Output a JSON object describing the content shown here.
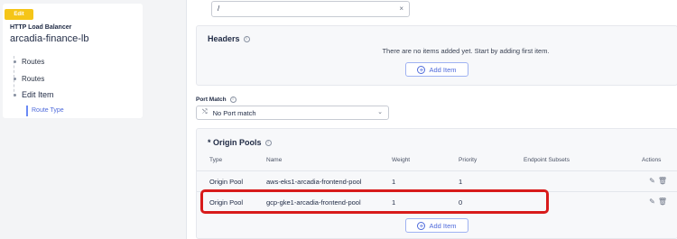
{
  "nav": {
    "badge": "Edit",
    "title": "HTTP Load Balancer",
    "lb_name": "arcadia-finance-lb",
    "items": [
      {
        "label": "Routes"
      },
      {
        "label": "Routes"
      },
      {
        "label": "Edit Item"
      }
    ],
    "sub_item": "Route Type"
  },
  "path_input": {
    "value": "/",
    "clear_icon": "×"
  },
  "headers": {
    "title": "Headers",
    "empty_text": "There are no items added yet. Start by adding first item.",
    "add_label": "Add Item"
  },
  "port_match": {
    "label": "Port Match",
    "selected": "No Port match"
  },
  "origin_pools": {
    "title": "* Origin Pools",
    "columns": [
      "Type",
      "Name",
      "Weight",
      "Priority",
      "Endpoint Subsets",
      "Actions"
    ],
    "rows": [
      {
        "type": "Origin Pool",
        "name": "aws-eks1-arcadia-frontend-pool",
        "weight": "1",
        "priority": "1"
      },
      {
        "type": "Origin Pool",
        "name": "gcp-gke1-arcadia-frontend-pool",
        "weight": "1",
        "priority": "0"
      }
    ],
    "add_label": "Add Item"
  },
  "colors": {
    "accent": "#4f6bdb",
    "badge": "#f5c518",
    "highlight": "#d81b1b"
  }
}
